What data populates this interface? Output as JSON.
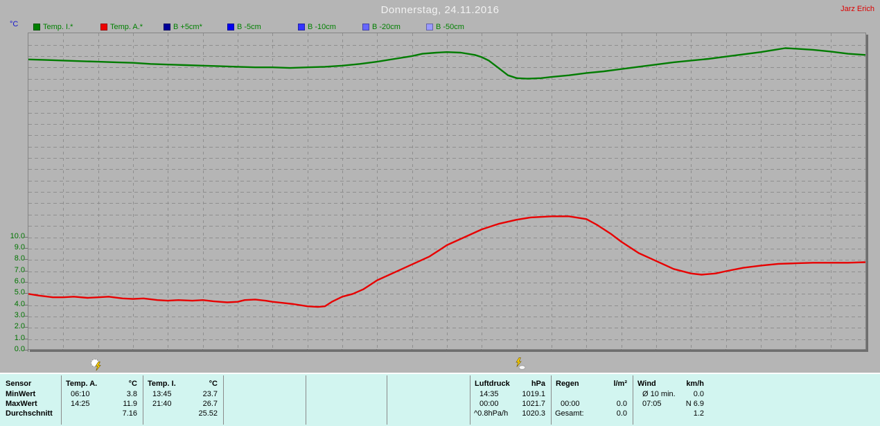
{
  "header": {
    "title": "Donnerstag, 24.11.2016",
    "user": "Jarz Erich"
  },
  "legend": {
    "axis_unit": "°C",
    "items": [
      {
        "label": "Temp. I.*",
        "color": "#008000",
        "plotted": true
      },
      {
        "label": "Temp. A.*",
        "color": "#ee0000",
        "plotted": true
      },
      {
        "label": "B +5cm*",
        "color": "#000099",
        "plotted": false
      },
      {
        "label": "B -5cm",
        "color": "#0000f0",
        "plotted": false
      },
      {
        "label": "B -10cm",
        "color": "#3333ff",
        "plotted": false
      },
      {
        "label": "B -20cm",
        "color": "#6666ff",
        "plotted": false
      },
      {
        "label": "B -50cm",
        "color": "#9999ff",
        "plotted": false
      }
    ]
  },
  "chart_data": {
    "type": "line",
    "title": "Donnerstag, 24.11.2016",
    "xlabel": "time of day, 00:00 to 24:00, vertical gridlines every hour",
    "ylabel": "°C",
    "x_hours_range": [
      0,
      24
    ],
    "ylim": [
      0,
      27.9
    ],
    "grid": true,
    "legend_position": "top",
    "yticks": [
      {
        "v": 0,
        "label": "0.0"
      },
      {
        "v": 1,
        "label": "1.0"
      },
      {
        "v": 2,
        "label": "2.0"
      },
      {
        "v": 3,
        "label": "3.0"
      },
      {
        "v": 4,
        "label": "4.0"
      },
      {
        "v": 5,
        "label": "5.0"
      },
      {
        "v": 6,
        "label": "6.0"
      },
      {
        "v": 7,
        "label": "7.0"
      },
      {
        "v": 8,
        "label": "8.0"
      },
      {
        "v": 9,
        "label": "9.0"
      },
      {
        "v": 10,
        "label": "10.0"
      }
    ],
    "series": [
      {
        "name": "Temp. I.*",
        "color": "#007c00",
        "points_hour_degC": [
          [
            0,
            25.7
          ],
          [
            0.5,
            25.65
          ],
          [
            1,
            25.6
          ],
          [
            1.5,
            25.55
          ],
          [
            2,
            25.5
          ],
          [
            2.5,
            25.45
          ],
          [
            3,
            25.4
          ],
          [
            3.5,
            25.3
          ],
          [
            4,
            25.25
          ],
          [
            4.5,
            25.2
          ],
          [
            5,
            25.15
          ],
          [
            5.5,
            25.1
          ],
          [
            6,
            25.05
          ],
          [
            6.5,
            25.0
          ],
          [
            7,
            25.0
          ],
          [
            7.5,
            24.95
          ],
          [
            8,
            25.0
          ],
          [
            8.5,
            25.05
          ],
          [
            9,
            25.15
          ],
          [
            9.5,
            25.3
          ],
          [
            10,
            25.5
          ],
          [
            10.5,
            25.75
          ],
          [
            11,
            26.0
          ],
          [
            11.3,
            26.2
          ],
          [
            11.7,
            26.3
          ],
          [
            12,
            26.35
          ],
          [
            12.4,
            26.3
          ],
          [
            12.8,
            26.1
          ],
          [
            13,
            25.9
          ],
          [
            13.2,
            25.6
          ],
          [
            13.5,
            24.9
          ],
          [
            13.75,
            24.3
          ],
          [
            14,
            24.05
          ],
          [
            14.3,
            24.0
          ],
          [
            14.7,
            24.05
          ],
          [
            15,
            24.15
          ],
          [
            15.5,
            24.3
          ],
          [
            16,
            24.5
          ],
          [
            16.5,
            24.65
          ],
          [
            17,
            24.85
          ],
          [
            17.5,
            25.05
          ],
          [
            18,
            25.25
          ],
          [
            18.5,
            25.45
          ],
          [
            19,
            25.6
          ],
          [
            19.5,
            25.75
          ],
          [
            20,
            25.95
          ],
          [
            20.5,
            26.15
          ],
          [
            21,
            26.35
          ],
          [
            21.4,
            26.55
          ],
          [
            21.7,
            26.7
          ],
          [
            22,
            26.65
          ],
          [
            22.5,
            26.55
          ],
          [
            23,
            26.4
          ],
          [
            23.5,
            26.2
          ],
          [
            24,
            26.1
          ]
        ]
      },
      {
        "name": "Temp. A.*",
        "color": "#e80000",
        "points_hour_degC": [
          [
            0,
            5.0
          ],
          [
            0.3,
            4.85
          ],
          [
            0.7,
            4.7
          ],
          [
            1,
            4.7
          ],
          [
            1.3,
            4.75
          ],
          [
            1.7,
            4.65
          ],
          [
            2,
            4.7
          ],
          [
            2.3,
            4.75
          ],
          [
            2.7,
            4.6
          ],
          [
            3,
            4.55
          ],
          [
            3.3,
            4.6
          ],
          [
            3.7,
            4.45
          ],
          [
            4,
            4.4
          ],
          [
            4.3,
            4.45
          ],
          [
            4.7,
            4.4
          ],
          [
            5,
            4.45
          ],
          [
            5.3,
            4.35
          ],
          [
            5.7,
            4.25
          ],
          [
            6,
            4.3
          ],
          [
            6.2,
            4.45
          ],
          [
            6.5,
            4.5
          ],
          [
            6.8,
            4.4
          ],
          [
            7,
            4.3
          ],
          [
            7.3,
            4.2
          ],
          [
            7.6,
            4.1
          ],
          [
            8,
            3.9
          ],
          [
            8.3,
            3.85
          ],
          [
            8.5,
            3.9
          ],
          [
            8.7,
            4.3
          ],
          [
            9,
            4.75
          ],
          [
            9.3,
            5.0
          ],
          [
            9.6,
            5.4
          ],
          [
            10,
            6.2
          ],
          [
            10.5,
            6.9
          ],
          [
            11,
            7.6
          ],
          [
            11.5,
            8.3
          ],
          [
            12,
            9.3
          ],
          [
            12.5,
            10.0
          ],
          [
            13,
            10.7
          ],
          [
            13.5,
            11.2
          ],
          [
            14,
            11.55
          ],
          [
            14.4,
            11.75
          ],
          [
            15,
            11.85
          ],
          [
            15.5,
            11.85
          ],
          [
            16,
            11.6
          ],
          [
            16.3,
            11.1
          ],
          [
            16.7,
            10.3
          ],
          [
            17,
            9.6
          ],
          [
            17.5,
            8.6
          ],
          [
            18,
            7.9
          ],
          [
            18.5,
            7.2
          ],
          [
            19,
            6.8
          ],
          [
            19.3,
            6.7
          ],
          [
            19.7,
            6.8
          ],
          [
            20,
            7.0
          ],
          [
            20.5,
            7.3
          ],
          [
            21,
            7.5
          ],
          [
            21.5,
            7.65
          ],
          [
            22,
            7.7
          ],
          [
            22.5,
            7.75
          ],
          [
            23,
            7.75
          ],
          [
            23.5,
            7.75
          ],
          [
            24,
            7.8
          ]
        ]
      }
    ],
    "axis_markers": [
      {
        "icon": "sun-bolt",
        "x_hour": 1.97
      },
      {
        "icon": "bolt-cloud",
        "x_hour": 14.15
      }
    ]
  },
  "table": {
    "row_labels": [
      "Sensor",
      "MinWert",
      "MaxWert",
      "Durchschnitt"
    ],
    "groups": [
      {
        "name": "Temp. A.",
        "unit": "°C",
        "min": [
          "06:10",
          "3.8"
        ],
        "max": [
          "14:25",
          "11.9"
        ],
        "avg": [
          "",
          "7.16"
        ]
      },
      {
        "name": "Temp. I.",
        "unit": "°C",
        "min": [
          "13:45",
          "23.7"
        ],
        "max": [
          "21:40",
          "26.7"
        ],
        "avg": [
          "",
          "25.52"
        ]
      },
      {
        "name": "",
        "unit": "",
        "min": [
          "",
          ""
        ],
        "max": [
          "",
          ""
        ],
        "avg": [
          "",
          ""
        ]
      },
      {
        "name": "",
        "unit": "",
        "min": [
          "",
          ""
        ],
        "max": [
          "",
          ""
        ],
        "avg": [
          "",
          ""
        ]
      },
      {
        "name": "",
        "unit": "",
        "min": [
          "",
          ""
        ],
        "max": [
          "",
          ""
        ],
        "avg": [
          "",
          ""
        ]
      },
      {
        "name": "Luftdruck",
        "unit": "hPa",
        "min": [
          "14:35",
          "1019.1"
        ],
        "max": [
          "00:00",
          "1021.7"
        ],
        "avg": [
          "^0.8hPa/h",
          "1020.3"
        ]
      },
      {
        "name": "Regen",
        "unit": "l/m²",
        "min": [
          "",
          ""
        ],
        "max": [
          "00:00",
          "0.0"
        ],
        "avg": [
          "Gesamt:",
          "0.0"
        ]
      },
      {
        "name": "Wind",
        "unit": "km/h",
        "min": [
          "Ø 10 min.",
          "0.0"
        ],
        "max": [
          "07:05",
          "N 6.9"
        ],
        "avg": [
          "",
          "1.2"
        ]
      }
    ]
  }
}
